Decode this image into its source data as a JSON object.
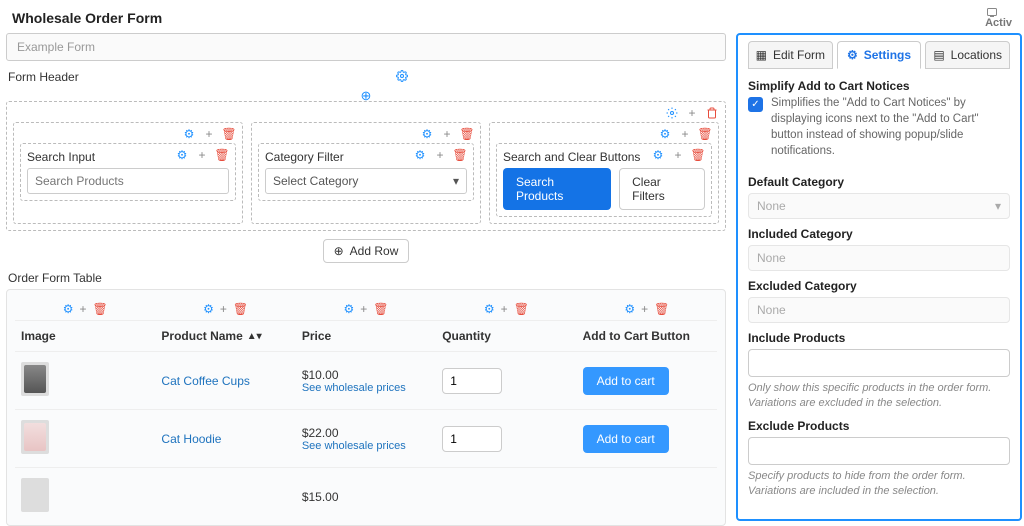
{
  "title": "Wholesale Order Form",
  "activ": "Activ",
  "crumb": "Example Form",
  "sections": {
    "formHeader": "Form Header",
    "orderFormTable": "Order Form Table"
  },
  "fields": {
    "searchInput": {
      "label": "Search Input",
      "placeholder": "Search Products"
    },
    "categoryFilter": {
      "label": "Category Filter",
      "value": "Select Category"
    },
    "buttonsBlock": {
      "label": "Search and Clear Buttons",
      "search": "Search Products",
      "clear": "Clear Filters"
    }
  },
  "addRow": "Add Row",
  "table": {
    "headers": {
      "image": "Image",
      "name": "Product Name",
      "price": "Price",
      "qty": "Quantity",
      "cart": "Add to Cart Button"
    },
    "rows": [
      {
        "name": "Cat Coffee Cups",
        "price": "$10.00",
        "sub": "See wholesale prices",
        "qty": "1",
        "cart": "Add to cart",
        "thumb": "cup"
      },
      {
        "name": "Cat Hoodie",
        "price": "$22.00",
        "sub": "See wholesale prices",
        "qty": "1",
        "cart": "Add to cart",
        "thumb": "hoodie"
      },
      {
        "name": "",
        "price": "$15.00",
        "sub": "",
        "qty": "",
        "cart": "",
        "thumb": ""
      }
    ]
  },
  "panel": {
    "tabs": {
      "edit": "Edit Form",
      "settings": "Settings",
      "locations": "Locations"
    },
    "notice": {
      "title": "Simplify Add to Cart Notices",
      "desc": "Simplifies the \"Add to Cart Notices\" by displaying icons next to the \"Add to Cart\" button instead of showing popup/slide notifications."
    },
    "defaultCategory": {
      "label": "Default Category",
      "value": "None"
    },
    "includedCategory": {
      "label": "Included Category",
      "value": "None"
    },
    "excludedCategory": {
      "label": "Excluded Category",
      "value": "None"
    },
    "includeProducts": {
      "label": "Include Products",
      "hint": "Only show this specific products in the order form. Variations are excluded in the selection."
    },
    "excludeProducts": {
      "label": "Exclude Products",
      "hint": "Specify products to hide from the order form. Variations are included in the selection."
    }
  }
}
